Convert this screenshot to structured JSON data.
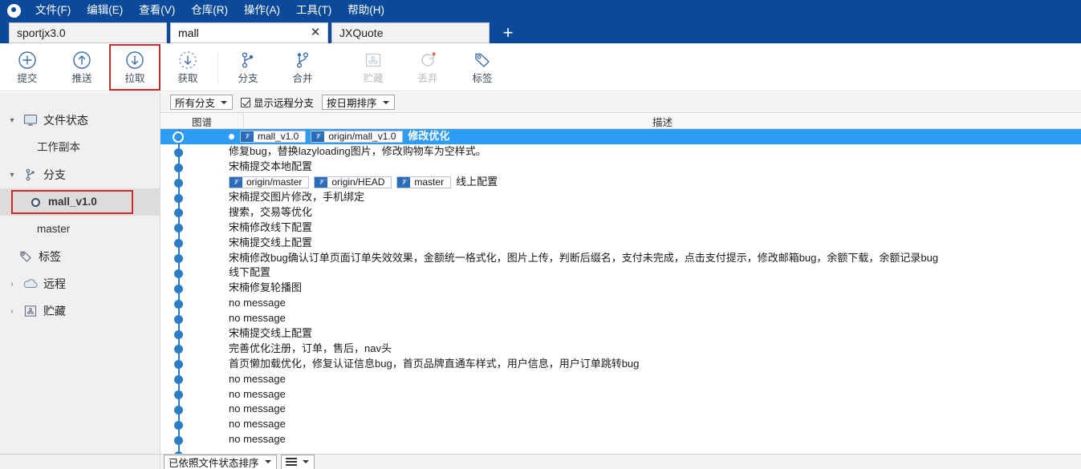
{
  "app": {
    "logo_icon": "sourcetree-logo-icon"
  },
  "menubar": {
    "items": [
      {
        "label": "文件(F)"
      },
      {
        "label": "编辑(E)"
      },
      {
        "label": "查看(V)"
      },
      {
        "label": "仓库(R)"
      },
      {
        "label": "操作(A)"
      },
      {
        "label": "工具(T)"
      },
      {
        "label": "帮助(H)"
      }
    ]
  },
  "tabs": {
    "items": [
      {
        "label": "sportjx3.0",
        "active": false
      },
      {
        "label": "mall",
        "active": true
      },
      {
        "label": "JXQuote",
        "active": false
      }
    ],
    "close_glyph": "✕",
    "add_label": "+"
  },
  "toolbar": {
    "items": [
      {
        "label": "提交",
        "icon": "commit-plus-icon",
        "disabled": false,
        "highlight": false
      },
      {
        "label": "推送",
        "icon": "push-up-arrow-icon",
        "disabled": false,
        "highlight": false
      },
      {
        "label": "拉取",
        "icon": "pull-down-arrow-icon",
        "disabled": false,
        "highlight": true
      },
      {
        "label": "获取",
        "icon": "fetch-dashed-icon",
        "disabled": false,
        "highlight": false
      },
      {
        "label": "分支",
        "icon": "branch-icon",
        "disabled": false,
        "highlight": false
      },
      {
        "label": "合并",
        "icon": "merge-icon",
        "disabled": false,
        "highlight": false
      },
      {
        "label": "贮藏",
        "icon": "stash-icon",
        "disabled": true,
        "highlight": false
      },
      {
        "label": "丢弃",
        "icon": "discard-refresh-icon",
        "disabled": true,
        "highlight": false
      },
      {
        "label": "标签",
        "icon": "tag-icon",
        "disabled": false,
        "highlight": false
      }
    ]
  },
  "filterbar": {
    "branch_filter": "所有分支",
    "show_remote_label": "显示远程分支",
    "show_remote_checked": true,
    "sort_order": "按日期排序"
  },
  "sidebar": {
    "sections": [
      {
        "label": "文件状态",
        "icon": "monitor-icon",
        "expanded": true,
        "chevron": "⌄"
      },
      {
        "label": "工作副本",
        "icon": "",
        "child": true
      },
      {
        "label": "分支",
        "icon": "branch-icon",
        "expanded": true,
        "chevron": "⌄"
      },
      {
        "label": "mall_v1.0",
        "icon": "branch-dot-icon",
        "child": true,
        "selected": true,
        "bold": true
      },
      {
        "label": "master",
        "icon": "",
        "child": true
      },
      {
        "label": "标签",
        "icon": "tag-icon"
      },
      {
        "label": "远程",
        "icon": "cloud-icon",
        "expanded": false,
        "chevron": "›"
      },
      {
        "label": "贮藏",
        "icon": "stash-icon",
        "expanded": false,
        "chevron": "›"
      }
    ]
  },
  "commit_list": {
    "columns": {
      "graph": "图谱",
      "description": "描述"
    },
    "rows": [
      {
        "selected": true,
        "head": true,
        "refs": [
          "mall_v1.0",
          "origin/mall_v1.0"
        ],
        "message": "修改优化"
      },
      {
        "selected": false,
        "refs": [],
        "message": "修复bug，替换lazyloading图片，修改购物车为空样式。"
      },
      {
        "selected": false,
        "refs": [],
        "message": "宋楠提交本地配置"
      },
      {
        "selected": false,
        "refs": [
          "origin/master",
          "origin/HEAD",
          "master"
        ],
        "message": "线上配置"
      },
      {
        "selected": false,
        "refs": [],
        "message": "宋楠提交图片修改，手机绑定"
      },
      {
        "selected": false,
        "refs": [],
        "message": "搜索，交易等优化"
      },
      {
        "selected": false,
        "refs": [],
        "message": "宋楠修改线下配置"
      },
      {
        "selected": false,
        "refs": [],
        "message": "宋楠提交线上配置"
      },
      {
        "selected": false,
        "refs": [],
        "message": "宋楠修改bug确认订单页面订单失效效果，金额统一格式化，图片上传，判断后缀名，支付未完成，点击支付提示，修改邮箱bug，余额下载，余额记录bug"
      },
      {
        "selected": false,
        "refs": [],
        "message": "线下配置"
      },
      {
        "selected": false,
        "refs": [],
        "message": "宋楠修复轮播图"
      },
      {
        "selected": false,
        "refs": [],
        "message": "no message"
      },
      {
        "selected": false,
        "refs": [],
        "message": "no message"
      },
      {
        "selected": false,
        "refs": [],
        "message": "宋楠提交线上配置"
      },
      {
        "selected": false,
        "refs": [],
        "message": "完善优化注册，订单，售后，nav头"
      },
      {
        "selected": false,
        "refs": [],
        "message": "首页懒加载优化，修复认证信息bug，首页品牌直通车样式，用户信息，用户订单跳转bug"
      },
      {
        "selected": false,
        "refs": [],
        "message": "no message"
      },
      {
        "selected": false,
        "refs": [],
        "message": "no message"
      },
      {
        "selected": false,
        "refs": [],
        "message": "no message"
      },
      {
        "selected": false,
        "refs": [],
        "message": "no message"
      },
      {
        "selected": false,
        "refs": [],
        "message": "no message"
      },
      {
        "selected": false,
        "refs": [],
        "message": ""
      }
    ]
  },
  "bottombar": {
    "sort_label": "已依照文件状态排序",
    "view_icon": "list-view-icon"
  },
  "colors": {
    "titlebar": "#0b4a9b",
    "selection": "#2e9bf5",
    "highlight_border": "#cc2b2b",
    "graph_line": "#2e7dc4",
    "badge_icon_bg": "#2b6cb8"
  }
}
